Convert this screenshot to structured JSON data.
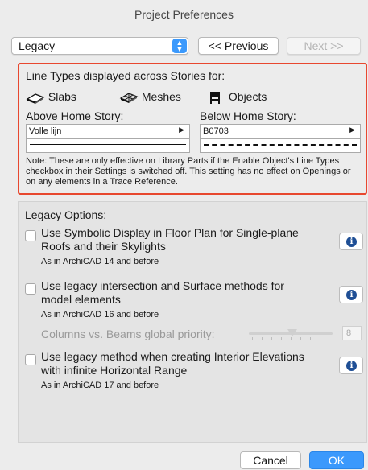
{
  "window": {
    "title": "Project Preferences"
  },
  "toolbar": {
    "page_select_value": "Legacy",
    "previous_label": "<< Previous",
    "next_label": "Next >>"
  },
  "line_types": {
    "heading": "Line Types displayed across Stories for:",
    "items": [
      {
        "label": "Slabs",
        "icon": "slab-icon"
      },
      {
        "label": "Meshes",
        "icon": "mesh-icon"
      },
      {
        "label": "Objects",
        "icon": "object-icon"
      }
    ],
    "above_label": "Above Home Story:",
    "above_value": "Volle lijn",
    "below_label": "Below Home Story:",
    "below_value": "B0703",
    "note": "Note: These are only effective on Library Parts if the Enable Object's Line Types checkbox in their Settings is switched off. This setting has no effect on Openings or on any elements in a Trace Reference.",
    "highlight_color": "#e8482f"
  },
  "legacy_options": {
    "title": "Legacy Options:",
    "options": [
      {
        "label": "Use Symbolic Display in Floor Plan for Single-plane Roofs and their Skylights",
        "sub": "As in ArchiCAD 14 and before",
        "checked": false
      },
      {
        "label": "Use legacy intersection and Surface methods for model elements",
        "sub": "As in ArchiCAD 16 and before",
        "checked": false
      },
      {
        "label": "Use legacy method when creating Interior Elevations with infinite Horizontal Range",
        "sub": "As in ArchiCAD 17 and before",
        "checked": false
      }
    ],
    "priority_label": "Columns vs. Beams global priority:",
    "priority_value": "8"
  },
  "footer": {
    "cancel_label": "Cancel",
    "ok_label": "OK",
    "accent_color": "#3b99fc"
  }
}
